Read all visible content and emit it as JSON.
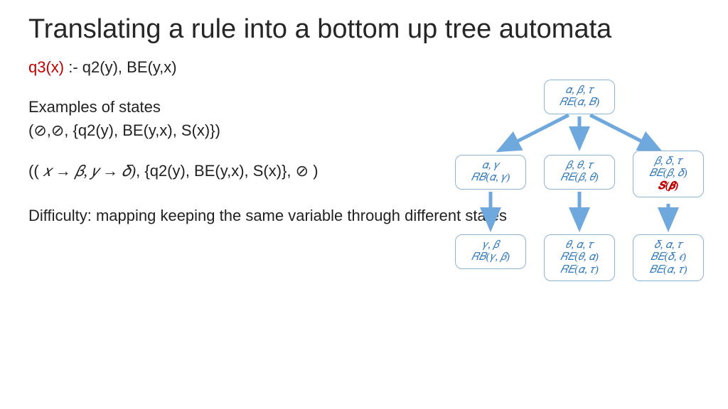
{
  "title": "Translating a rule into a bottom up tree automata",
  "rule": {
    "head": "q3(x)",
    "sep": " :- ",
    "body": "q2(y), BE(y,x)"
  },
  "examples_label": "Examples of states",
  "state1": "(⊘,⊘, {q2(y), BE(y,x), S(x)})",
  "state2": {
    "open": "((",
    "map": " 𝑥  →   𝛽, 𝑦 →   𝛿)",
    "sep": ", {",
    "body": "q2(y), BE(y,x), S(x)}, ",
    "empty": "⊘",
    "close": "   )"
  },
  "difficulty": "Difficulty: mapping keeping the same variable through different states",
  "tree": {
    "root": {
      "l1": "𝛼, 𝛽, 𝜏",
      "l2": "𝑅𝐸(𝛼, 𝐵)"
    },
    "mid": [
      {
        "l1": "𝛼, 𝛾",
        "l2": "𝑅𝐵(𝛼, 𝛾)"
      },
      {
        "l1": "𝛽, 𝜃, 𝜏",
        "l2": "𝑅𝐸(𝛽, 𝜃)"
      },
      {
        "l1": "𝛽, 𝛿, 𝜏",
        "l2": "𝐵𝐸(𝛽, 𝛿)",
        "l3": "𝑺(𝜷)"
      }
    ],
    "leaf": [
      {
        "l1": "𝛾, 𝛽",
        "l2": "𝑅𝐵(𝛾, 𝛽)"
      },
      {
        "l1": "𝜃, 𝛼, 𝜏",
        "l2": "𝑅𝐸(𝜃, 𝛼)",
        "l3": "𝑅𝐸(𝛼, 𝜏)"
      },
      {
        "l1": "𝛿, 𝛼, 𝜏",
        "l2": "𝐵𝐸(𝛿, 𝜖)",
        "l3": "𝐵𝐸(𝛼, 𝜏)"
      }
    ]
  }
}
